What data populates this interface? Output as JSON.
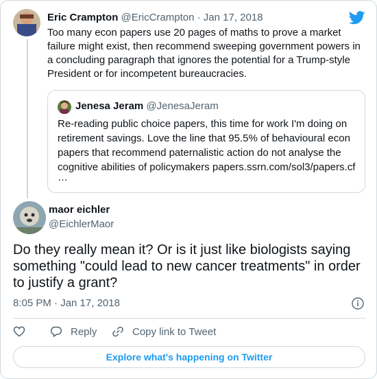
{
  "brand": {
    "accent": "#1d9bf0",
    "text": "#0f1419",
    "muted": "#536471",
    "border": "#cfd9de"
  },
  "parent_tweet": {
    "author_name": "Eric Crampton",
    "handle": "@EricCrampton",
    "separator": "·",
    "date": "Jan 17, 2018",
    "text": "Too many econ papers use 20 pages of maths to prove a market failure might exist, then recommend sweeping government powers in a concluding paragraph that ignores the potential for a Trump-style President or for incompetent bureaucracies."
  },
  "quoted_tweet": {
    "author_name": "Jenesa Jeram",
    "handle": "@JenesaJeram",
    "text": "Re-reading public choice papers, this time for work I'm doing on retirement savings. Love the line that 95.5% of behavioural econ papers that recommend paternalistic action do not analyse the cognitive abilities of policymakers papers.ssrn.com/sol3/papers.cf",
    "ellipsis": "…"
  },
  "main_tweet": {
    "author_name": "maor eichler",
    "handle": "@EichlerMaor",
    "text": "Do they really mean it? Or is it just like biologists saying something \"could lead to new cancer treatments\" in order to justify a grant?",
    "timestamp": "8:05 PM · Jan 17, 2018"
  },
  "actions": {
    "like_icon": "heart-icon",
    "reply_label": "Reply",
    "copy_link_label": "Copy link to Tweet"
  },
  "footer": {
    "explore_label": "Explore what's happening on Twitter"
  }
}
